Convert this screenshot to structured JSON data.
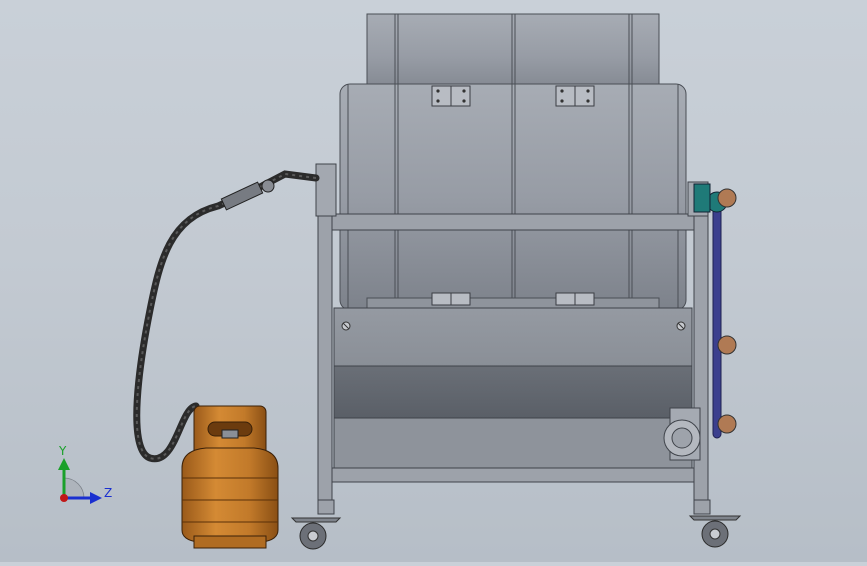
{
  "viewport": {
    "background_top": "#c9d0d8",
    "background_bottom": "#b6bec7"
  },
  "model": {
    "steel_color": "#8e939c",
    "drum_color": "#9aa0a8",
    "belt_color": "#3b3f8e",
    "cylinder_color": "#c27a2a",
    "hose_color": "#2b2b2b"
  },
  "triad": {
    "y_label": "Y",
    "z_label": "Z",
    "y_color": "#1aa02a",
    "z_color": "#1a2fd0",
    "x_color": "#c01818"
  }
}
